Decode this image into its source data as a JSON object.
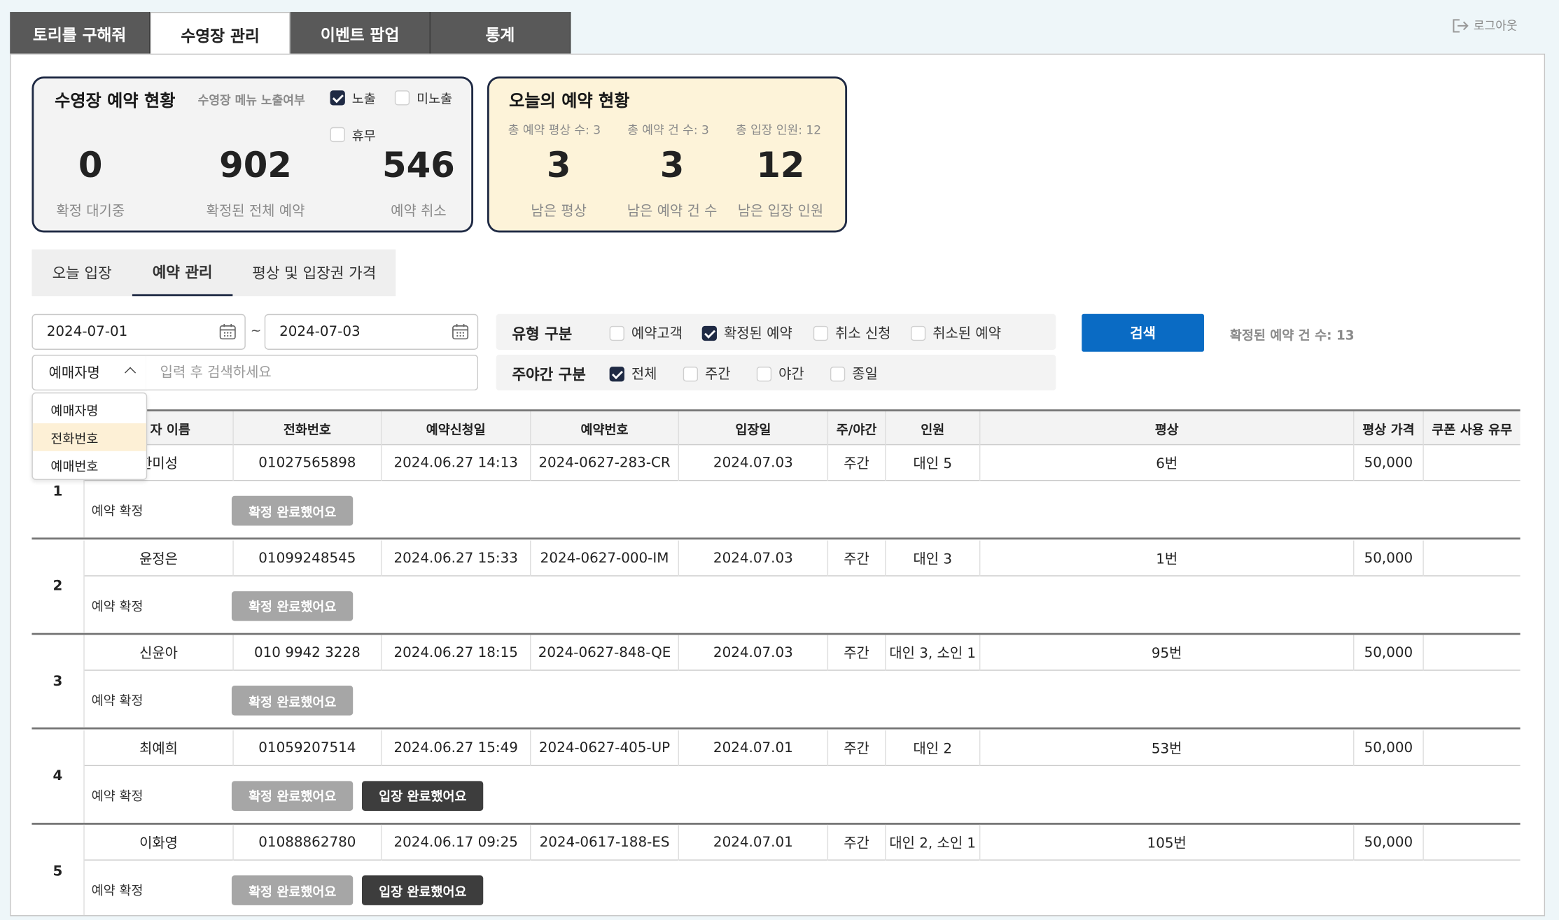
{
  "top_tabs": [
    "토리를 구해줘",
    "수영장 관리",
    "이벤트 팝업",
    "통계"
  ],
  "logout_label": "로그아웃",
  "pool_status": {
    "title": "수영장 예약 현황",
    "menu_label": "수영장 메뉴 노출여부",
    "options": [
      {
        "label": "노출",
        "checked": true
      },
      {
        "label": "미노출",
        "checked": false
      },
      {
        "label": "휴무",
        "checked": false
      }
    ],
    "stats": [
      {
        "value": "0",
        "label": "확정 대기중"
      },
      {
        "value": "902",
        "label": "확정된 전체 예약"
      },
      {
        "value": "546",
        "label": "예약 취소"
      }
    ]
  },
  "today_status": {
    "title": "오늘의 예약 현황",
    "totals": [
      "총 예약 평상 수: 3",
      "총 예약 건 수: 3",
      "총 입장 인원: 12"
    ],
    "stats": [
      {
        "value": "3",
        "label": "남은 평상"
      },
      {
        "value": "3",
        "label": "남은 예약 건 수"
      },
      {
        "value": "12",
        "label": "남은 입장 인원"
      }
    ],
    "background": "#fdf3d9"
  },
  "sub_tabs": [
    "오늘 입장",
    "예약 관리",
    "평상 및 입장권 가격"
  ],
  "filters": {
    "date_from": "2024-07-01",
    "date_sep": "~",
    "date_to": "2024-07-03",
    "search_type": "예매자명",
    "search_placeholder": "입력 후 검색하세요",
    "dropdown_options": [
      "예매자명",
      "전화번호",
      "예매번호"
    ],
    "type_label": "유형 구분",
    "type_options": [
      {
        "label": "예약고객",
        "checked": false
      },
      {
        "label": "확정된 예약",
        "checked": true
      },
      {
        "label": "취소 신청",
        "checked": false
      },
      {
        "label": "취소된 예약",
        "checked": false
      }
    ],
    "daynight_label": "주야간 구분",
    "daynight_options": [
      {
        "label": "전체",
        "checked": true
      },
      {
        "label": "주간",
        "checked": false
      },
      {
        "label": "야간",
        "checked": false
      },
      {
        "label": "종일",
        "checked": false
      }
    ],
    "search_button": "검색",
    "result_count": "확정된 예약 건 수: 13"
  },
  "table": {
    "headers": [
      "",
      "예약자 이름",
      "전화번호",
      "예약신청일",
      "예약번호",
      "입장일",
      "주/야간",
      "인원",
      "평상",
      "평상 가격",
      "쿠폰 사용 유무"
    ],
    "visible_header_name": "자 이름",
    "confirm_label": "예약 확정",
    "confirm_button": "확정 완료했어요",
    "entry_button": "입장 완료했어요",
    "rows": [
      {
        "no": "1",
        "name": "한미성",
        "phone": "01027565898",
        "applied": "2024.06.27  14:13",
        "code": "2024-0627-283-CR",
        "entry": "2024.07.03",
        "time": "주간",
        "people": "대인 5",
        "deck": "6번",
        "price": "50,000",
        "coupon": ""
      },
      {
        "no": "2",
        "name": "윤정은",
        "phone": "01099248545",
        "applied": "2024.06.27  15:33",
        "code": "2024-0627-000-IM",
        "entry": "2024.07.03",
        "time": "주간",
        "people": "대인 3",
        "deck": "1번",
        "price": "50,000",
        "coupon": ""
      },
      {
        "no": "3",
        "name": "신윤아",
        "phone": "010 9942 3228",
        "applied": "2024.06.27  18:15",
        "code": "2024-0627-848-QE",
        "entry": "2024.07.03",
        "time": "주간",
        "people": "대인 3, 소인 1",
        "deck": "95번",
        "price": "50,000",
        "coupon": ""
      },
      {
        "no": "4",
        "name": "최예희",
        "phone": "01059207514",
        "applied": "2024.06.27  15:49",
        "code": "2024-0627-405-UP",
        "entry": "2024.07.01",
        "time": "주간",
        "people": "대인 2",
        "deck": "53번",
        "price": "50,000",
        "coupon": ""
      },
      {
        "no": "5",
        "name": "이화영",
        "phone": "01088862780",
        "applied": "2024.06.17  09:25",
        "code": "2024-0617-188-ES",
        "entry": "2024.07.01",
        "time": "주간",
        "people": "대인 2, 소인 1",
        "deck": "105번",
        "price": "50,000",
        "coupon": ""
      }
    ]
  },
  "colors": {
    "accent": "#0a6bc4",
    "tab_dark": "#595959",
    "card_border": "#1f2a44",
    "dropdown_highlight": "#fdf0d6"
  }
}
